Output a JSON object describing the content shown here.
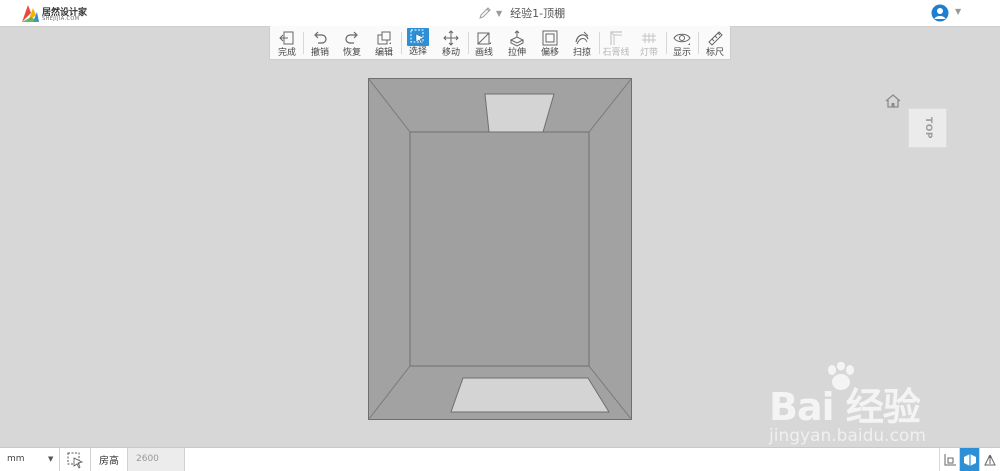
{
  "header": {
    "logo_name": "居然设计家",
    "logo_domain": "SHEJIJIA.COM",
    "title": "经验1-顶棚",
    "pencil_icon": "pencil-icon",
    "user_icon": "user-avatar-icon"
  },
  "toolbar": {
    "items": [
      {
        "label": "完成",
        "icon": "exit-icon",
        "state": "normal"
      },
      {
        "label": "撤销",
        "icon": "undo-icon",
        "state": "normal"
      },
      {
        "label": "恢复",
        "icon": "redo-icon",
        "state": "normal"
      },
      {
        "label": "编辑",
        "icon": "edit-icon",
        "state": "normal"
      },
      {
        "label": "选择",
        "icon": "select-cursor-icon",
        "state": "active"
      },
      {
        "label": "移动",
        "icon": "move-icon",
        "state": "normal"
      },
      {
        "label": "画线",
        "icon": "draw-line-icon",
        "state": "normal"
      },
      {
        "label": "拉伸",
        "icon": "extrude-icon",
        "state": "normal"
      },
      {
        "label": "偏移",
        "icon": "offset-icon",
        "state": "normal"
      },
      {
        "label": "扫掠",
        "icon": "sweep-icon",
        "state": "normal"
      },
      {
        "label": "石膏线",
        "icon": "molding-icon",
        "state": "disabled"
      },
      {
        "label": "灯带",
        "icon": "light-strip-icon",
        "state": "disabled"
      },
      {
        "label": "显示",
        "icon": "eye-icon",
        "state": "normal"
      },
      {
        "label": "标尺",
        "icon": "ruler-icon",
        "state": "normal"
      }
    ]
  },
  "viewport": {
    "view_cube_label": "TOP",
    "home_icon": "home-icon",
    "colors": {
      "background": "#d7d7d7",
      "ceiling": "#a2a2a2",
      "opening": "#d4d4d4",
      "accent": "#2d8fd6"
    }
  },
  "watermark": {
    "brand": "Bai 经验",
    "url": "jingyan.baidu.com"
  },
  "statusbar": {
    "unit": "mm",
    "room_height_label": "房高",
    "room_height_value": "2600",
    "view_buttons": [
      {
        "icon": "2d-view-icon",
        "active": false
      },
      {
        "icon": "3d-view-icon",
        "active": true
      },
      {
        "icon": "roam-view-icon",
        "active": false
      }
    ]
  }
}
